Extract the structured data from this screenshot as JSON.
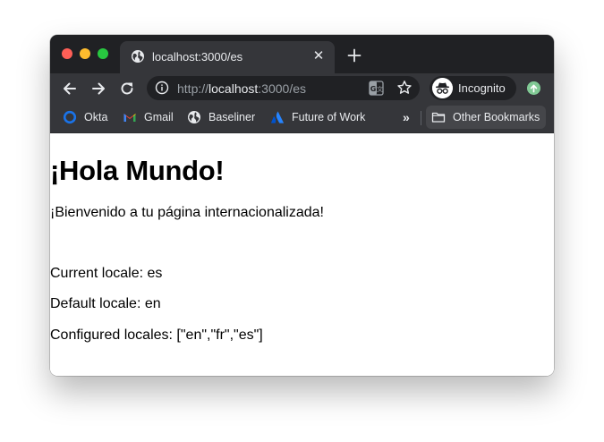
{
  "browser": {
    "tab": {
      "title": "localhost:3000/es",
      "close_symbol": "✕",
      "favicon": "globe-icon"
    },
    "toolbar": {
      "url": {
        "scheme": "http://",
        "host": "localhost",
        "port_path": ":3000/es"
      },
      "profile_label": "Incognito",
      "icons": [
        "back-arrow-icon",
        "forward-arrow-icon",
        "reload-icon",
        "info-icon",
        "translate-icon",
        "star-icon",
        "incognito-icon",
        "update-icon"
      ]
    },
    "bookmarks": {
      "items": [
        {
          "label": "Okta",
          "icon": "okta-icon"
        },
        {
          "label": "Gmail",
          "icon": "gmail-icon"
        },
        {
          "label": "Baseliner",
          "icon": "globe-icon"
        },
        {
          "label": "Future of Work",
          "icon": "atlassian-icon"
        }
      ],
      "overflow_symbol": "»",
      "other_label": "Other Bookmarks"
    },
    "colors": {
      "tabstrip_bg": "#202124",
      "toolbar_bg": "#35363a",
      "text_light": "#e8eaed",
      "text_dim": "#9aa0a6",
      "traffic_close": "#ff5f57",
      "traffic_minimize": "#febc2e",
      "traffic_maximize": "#28c840",
      "update_badge": "#81c995"
    }
  },
  "page": {
    "heading": "¡Hola Mundo!",
    "welcome": "¡Bienvenido a tu página internacionalizada!",
    "current_locale": "Current locale: es",
    "default_locale": "Default locale: en",
    "configured_locales": "Configured locales: [\"en\",\"fr\",\"es\"]"
  }
}
